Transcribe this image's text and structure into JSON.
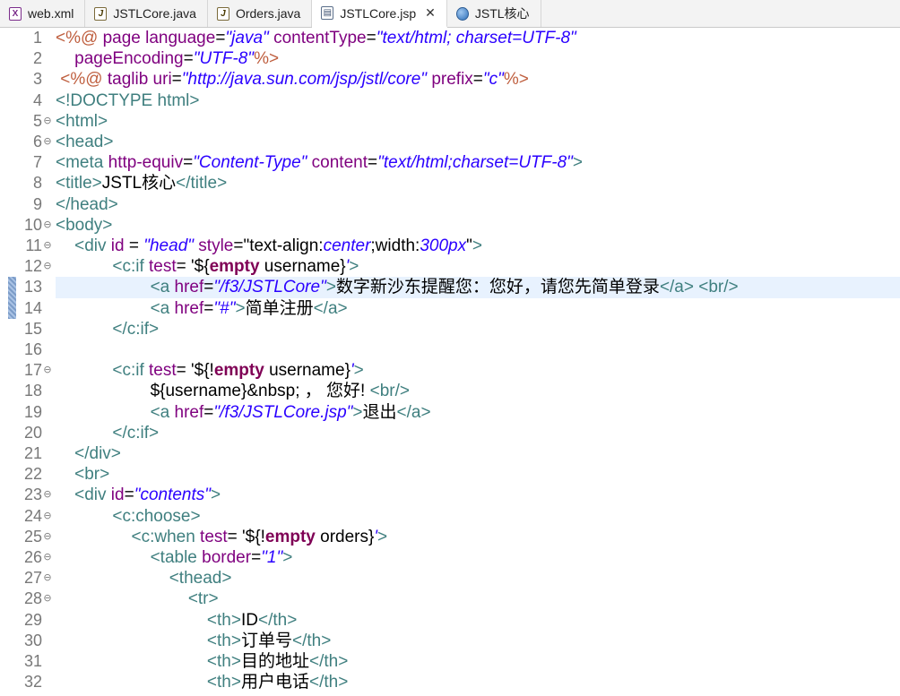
{
  "tabs": [
    {
      "label": "web.xml",
      "icon": "xml-file-icon",
      "glyph": "X",
      "kind": "xml",
      "active": false
    },
    {
      "label": "JSTLCore.java",
      "icon": "java-file-icon",
      "glyph": "J",
      "kind": "java",
      "active": false
    },
    {
      "label": "Orders.java",
      "icon": "java-file-icon",
      "glyph": "J",
      "kind": "java",
      "active": false
    },
    {
      "label": "JSTLCore.jsp",
      "icon": "jsp-file-icon",
      "glyph": "▤",
      "kind": "jsp",
      "active": true,
      "close": "✕"
    },
    {
      "label": "JSTL核心",
      "icon": "browser-globe-icon",
      "glyph": "",
      "kind": "globe",
      "active": false
    }
  ],
  "editor": {
    "current_line": 13,
    "lines": [
      {
        "n": "1",
        "fold": "",
        "tokens": [
          [
            "jsp",
            "<%@ "
          ],
          [
            "attr",
            "page "
          ],
          [
            "attr",
            "language"
          ],
          [
            "text",
            "="
          ],
          [
            "val",
            "\"java\""
          ],
          [
            "text",
            " "
          ],
          [
            "attr",
            "contentType"
          ],
          [
            "text",
            "="
          ],
          [
            "val",
            "\"text/html; charset=UTF-8\""
          ]
        ]
      },
      {
        "n": "2",
        "fold": "",
        "tokens": [
          [
            "text",
            "    "
          ],
          [
            "attr",
            "pageEncoding"
          ],
          [
            "text",
            "="
          ],
          [
            "val",
            "\"UTF-8\""
          ],
          [
            "jsp",
            "%>"
          ]
        ]
      },
      {
        "n": "3",
        "fold": "",
        "tokens": [
          [
            "text",
            " "
          ],
          [
            "jsp",
            "<%@ "
          ],
          [
            "attr",
            "taglib "
          ],
          [
            "attr",
            "uri"
          ],
          [
            "text",
            "="
          ],
          [
            "val",
            "\"http://java.sun.com/jsp/jstl/core\""
          ],
          [
            "text",
            " "
          ],
          [
            "attr",
            "prefix"
          ],
          [
            "text",
            "="
          ],
          [
            "val",
            "\"c\""
          ],
          [
            "jsp",
            "%>"
          ]
        ]
      },
      {
        "n": "4",
        "fold": "",
        "tokens": [
          [
            "tag",
            "<!DOCTYPE html>"
          ]
        ]
      },
      {
        "n": "5",
        "fold": "⊖",
        "tokens": [
          [
            "tag",
            "<html>"
          ]
        ]
      },
      {
        "n": "6",
        "fold": "⊖",
        "tokens": [
          [
            "tag",
            "<head>"
          ]
        ]
      },
      {
        "n": "7",
        "fold": "",
        "tokens": [
          [
            "tag",
            "<meta "
          ],
          [
            "attr",
            "http-equiv"
          ],
          [
            "text",
            "="
          ],
          [
            "val",
            "\"Content-Type\""
          ],
          [
            "text",
            " "
          ],
          [
            "attr",
            "content"
          ],
          [
            "text",
            "="
          ],
          [
            "val",
            "\"text/html;charset=UTF-8\""
          ],
          [
            "tag",
            ">"
          ]
        ]
      },
      {
        "n": "8",
        "fold": "",
        "tokens": [
          [
            "tag",
            "<title>"
          ],
          [
            "text",
            "JSTL核心"
          ],
          [
            "tag",
            "</title>"
          ]
        ]
      },
      {
        "n": "9",
        "fold": "",
        "tokens": [
          [
            "tag",
            "</head>"
          ]
        ]
      },
      {
        "n": "10",
        "fold": "⊖",
        "tokens": [
          [
            "tag",
            "<body>"
          ]
        ]
      },
      {
        "n": "11",
        "fold": "⊖",
        "tokens": [
          [
            "text",
            "    "
          ],
          [
            "tag",
            "<div "
          ],
          [
            "attr",
            "id"
          ],
          [
            "text",
            " = "
          ],
          [
            "val",
            "\"head\""
          ],
          [
            "text",
            " "
          ],
          [
            "attr",
            "style"
          ],
          [
            "text",
            "=\"text-align:"
          ],
          [
            "val",
            "center"
          ],
          [
            "text",
            ";width:"
          ],
          [
            "val",
            "300px"
          ],
          [
            "text",
            "\""
          ],
          [
            "tag",
            ">"
          ]
        ]
      },
      {
        "n": "12",
        "fold": "⊖",
        "tokens": [
          [
            "text",
            "            "
          ],
          [
            "tag",
            "<c:if "
          ],
          [
            "attr",
            "test"
          ],
          [
            "text",
            "= '${"
          ],
          [
            "kw",
            "empty"
          ],
          [
            "text",
            " username}"
          ],
          [
            "val",
            "'"
          ],
          [
            "tag",
            ">"
          ]
        ]
      },
      {
        "n": "13",
        "fold": "",
        "tokens": [
          [
            "text",
            "                    "
          ],
          [
            "tag",
            "<a "
          ],
          [
            "attr",
            "href"
          ],
          [
            "text",
            "="
          ],
          [
            "val",
            "\"/f3/JSTLCore\""
          ],
          [
            "tag",
            ">"
          ],
          [
            "text",
            "数字新沙东提醒您：您好，请您先简单登录"
          ],
          [
            "tag",
            "</a>"
          ],
          [
            "text",
            " "
          ],
          [
            "tag",
            "<br/>"
          ]
        ]
      },
      {
        "n": "14",
        "fold": "",
        "tokens": [
          [
            "text",
            "                    "
          ],
          [
            "tag",
            "<a "
          ],
          [
            "attr",
            "href"
          ],
          [
            "text",
            "="
          ],
          [
            "val",
            "\"#\""
          ],
          [
            "tag",
            ">"
          ],
          [
            "text",
            "简单注册"
          ],
          [
            "tag",
            "</a>"
          ]
        ]
      },
      {
        "n": "15",
        "fold": "",
        "tokens": [
          [
            "text",
            "            "
          ],
          [
            "tag",
            "</c:if>"
          ]
        ]
      },
      {
        "n": "16",
        "fold": "",
        "tokens": []
      },
      {
        "n": "17",
        "fold": "⊖",
        "tokens": [
          [
            "text",
            "            "
          ],
          [
            "tag",
            "<c:if "
          ],
          [
            "attr",
            "test"
          ],
          [
            "text",
            "= '${!"
          ],
          [
            "kw",
            "empty"
          ],
          [
            "text",
            " username}"
          ],
          [
            "val",
            "'"
          ],
          [
            "tag",
            ">"
          ]
        ]
      },
      {
        "n": "18",
        "fold": "",
        "tokens": [
          [
            "text",
            "                    ${username}&nbsp; ， 您好! "
          ],
          [
            "tag",
            "<br/>"
          ]
        ]
      },
      {
        "n": "19",
        "fold": "",
        "tokens": [
          [
            "text",
            "                    "
          ],
          [
            "tag",
            "<a "
          ],
          [
            "attr",
            "href"
          ],
          [
            "text",
            "="
          ],
          [
            "val",
            "\"/f3/JSTLCore.jsp\""
          ],
          [
            "tag",
            ">"
          ],
          [
            "text",
            "退出"
          ],
          [
            "tag",
            "</a>"
          ]
        ]
      },
      {
        "n": "20",
        "fold": "",
        "tokens": [
          [
            "text",
            "            "
          ],
          [
            "tag",
            "</c:if>"
          ]
        ]
      },
      {
        "n": "21",
        "fold": "",
        "tokens": [
          [
            "text",
            "    "
          ],
          [
            "tag",
            "</div>"
          ]
        ]
      },
      {
        "n": "22",
        "fold": "",
        "tokens": [
          [
            "text",
            "    "
          ],
          [
            "tag",
            "<br>"
          ]
        ]
      },
      {
        "n": "23",
        "fold": "⊖",
        "tokens": [
          [
            "text",
            "    "
          ],
          [
            "tag",
            "<div "
          ],
          [
            "attr",
            "id"
          ],
          [
            "text",
            "="
          ],
          [
            "val",
            "\"contents\""
          ],
          [
            "tag",
            ">"
          ]
        ]
      },
      {
        "n": "24",
        "fold": "⊖",
        "tokens": [
          [
            "text",
            "            "
          ],
          [
            "tag",
            "<c:choose>"
          ]
        ]
      },
      {
        "n": "25",
        "fold": "⊖",
        "tokens": [
          [
            "text",
            "                "
          ],
          [
            "tag",
            "<c:when "
          ],
          [
            "attr",
            "test"
          ],
          [
            "text",
            "= '${!"
          ],
          [
            "kw",
            "empty"
          ],
          [
            "text",
            " orders}"
          ],
          [
            "val",
            "'"
          ],
          [
            "tag",
            ">"
          ]
        ]
      },
      {
        "n": "26",
        "fold": "⊖",
        "tokens": [
          [
            "text",
            "                    "
          ],
          [
            "tag",
            "<table "
          ],
          [
            "attr",
            "border"
          ],
          [
            "text",
            "="
          ],
          [
            "val",
            "\"1\""
          ],
          [
            "tag",
            ">"
          ]
        ]
      },
      {
        "n": "27",
        "fold": "⊖",
        "tokens": [
          [
            "text",
            "                        "
          ],
          [
            "tag",
            "<thead>"
          ]
        ]
      },
      {
        "n": "28",
        "fold": "⊖",
        "tokens": [
          [
            "text",
            "                            "
          ],
          [
            "tag",
            "<tr>"
          ]
        ]
      },
      {
        "n": "29",
        "fold": "",
        "tokens": [
          [
            "text",
            "                                "
          ],
          [
            "tag",
            "<th>"
          ],
          [
            "text",
            "ID"
          ],
          [
            "tag",
            "</th>"
          ]
        ]
      },
      {
        "n": "30",
        "fold": "",
        "tokens": [
          [
            "text",
            "                                "
          ],
          [
            "tag",
            "<th>"
          ],
          [
            "text",
            "订单号"
          ],
          [
            "tag",
            "</th>"
          ]
        ]
      },
      {
        "n": "31",
        "fold": "",
        "tokens": [
          [
            "text",
            "                                "
          ],
          [
            "tag",
            "<th>"
          ],
          [
            "text",
            "目的地址"
          ],
          [
            "tag",
            "</th>"
          ]
        ]
      },
      {
        "n": "32",
        "fold": "",
        "tokens": [
          [
            "text",
            "                                "
          ],
          [
            "tag",
            "<th>"
          ],
          [
            "text",
            "用户电话"
          ],
          [
            "tag",
            "</th>"
          ]
        ]
      }
    ]
  }
}
